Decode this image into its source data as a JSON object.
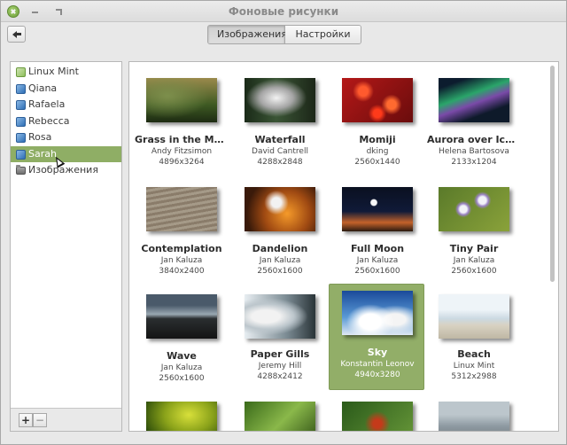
{
  "window": {
    "title": "Фоновые рисунки"
  },
  "toolbar": {
    "tabs": [
      {
        "label": "Изображения",
        "active": true
      },
      {
        "label": "Настройки",
        "active": false
      }
    ]
  },
  "sidebar": {
    "items": [
      {
        "label": "Linux Mint",
        "icon": "mint-folder-icon",
        "selected": false
      },
      {
        "label": "Qiana",
        "icon": "blue-folder-icon",
        "selected": false
      },
      {
        "label": "Rafaela",
        "icon": "blue-folder-icon",
        "selected": false
      },
      {
        "label": "Rebecca",
        "icon": "blue-folder-icon",
        "selected": false
      },
      {
        "label": "Rosa",
        "icon": "blue-folder-icon",
        "selected": false
      },
      {
        "label": "Sarah",
        "icon": "blue-folder-icon",
        "selected": true
      },
      {
        "label": "Изображения",
        "icon": "folder-icon",
        "selected": false
      }
    ],
    "add_label": "+",
    "remove_label": "−"
  },
  "wallpapers": [
    {
      "name": "Grass in the Morn…",
      "author": "Andy Fitzsimon",
      "size": "4896x3264",
      "selected": false
    },
    {
      "name": "Waterfall",
      "author": "David Cantrell",
      "size": "4288x2848",
      "selected": false
    },
    {
      "name": "Momiji",
      "author": "dking",
      "size": "2560x1440",
      "selected": false
    },
    {
      "name": "Aurora over Icela…",
      "author": "Helena Bartosova",
      "size": "2133x1204",
      "selected": false
    },
    {
      "name": "Contemplation",
      "author": "Jan Kaluza",
      "size": "3840x2400",
      "selected": false
    },
    {
      "name": "Dandelion",
      "author": "Jan Kaluza",
      "size": "2560x1600",
      "selected": false
    },
    {
      "name": "Full Moon",
      "author": "Jan Kaluza",
      "size": "2560x1600",
      "selected": false
    },
    {
      "name": "Tiny Pair",
      "author": "Jan Kaluza",
      "size": "2560x1600",
      "selected": false
    },
    {
      "name": "Wave",
      "author": "Jan Kaluza",
      "size": "2560x1600",
      "selected": false
    },
    {
      "name": "Paper Gills",
      "author": "Jeremy Hill",
      "size": "4288x2412",
      "selected": false
    },
    {
      "name": "Sky",
      "author": "Konstantin Leonov",
      "size": "4940x3280",
      "selected": true
    },
    {
      "name": "Beach",
      "author": "Linux Mint",
      "size": "5312x2988",
      "selected": false
    }
  ],
  "colors": {
    "selection_green": "#8fae65",
    "window_bg": "#e8e8e8"
  }
}
